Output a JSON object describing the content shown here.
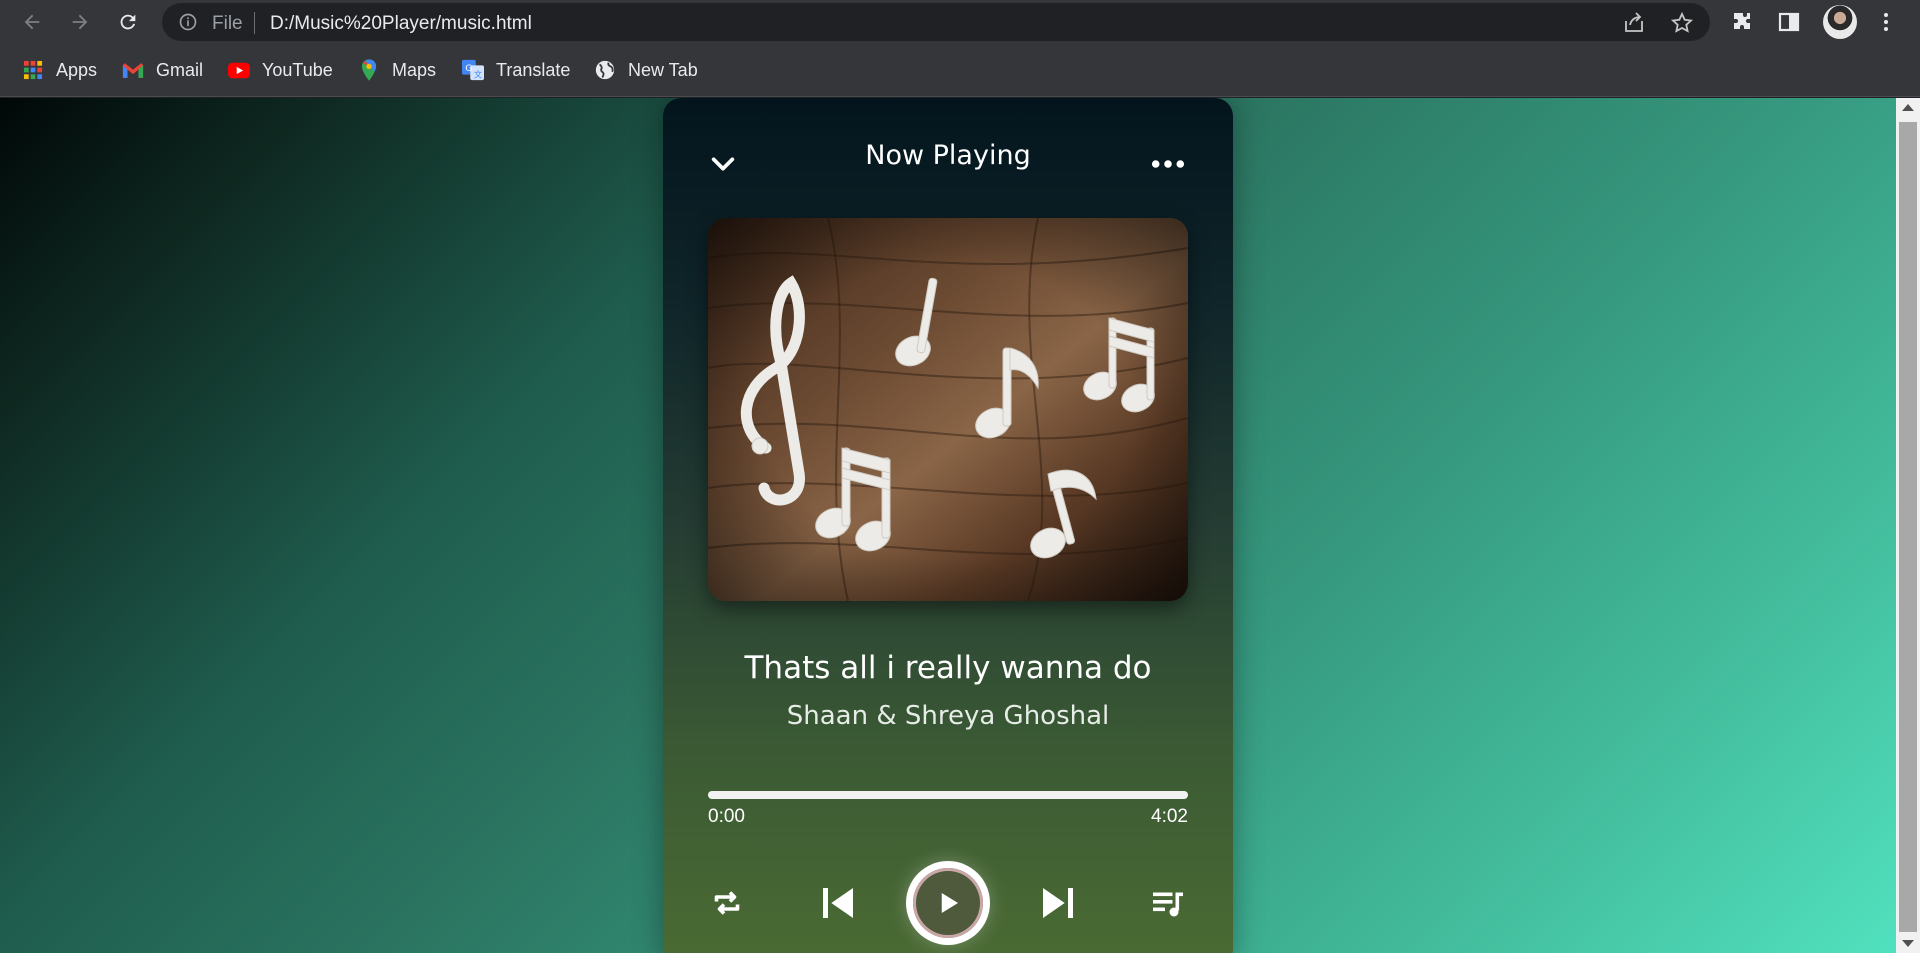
{
  "browser": {
    "file_label": "File",
    "url": "D:/Music%20Player/music.html",
    "bookmarks": [
      {
        "label": "Apps",
        "icon": "apps-grid-icon"
      },
      {
        "label": "Gmail",
        "icon": "gmail-icon"
      },
      {
        "label": "YouTube",
        "icon": "youtube-icon"
      },
      {
        "label": "Maps",
        "icon": "maps-pin-icon"
      },
      {
        "label": "Translate",
        "icon": "translate-icon"
      },
      {
        "label": "New Tab",
        "icon": "globe-icon"
      }
    ]
  },
  "player": {
    "header": "Now Playing",
    "song_title": "Thats all i really wanna do",
    "artist": "Shaan & Shreya Ghoshal",
    "current_time": "0:00",
    "duration": "4:02",
    "progress_fraction": 1.0,
    "colors": {
      "accent": "#ffffff",
      "progress_fill": "#f2f2f2"
    }
  }
}
